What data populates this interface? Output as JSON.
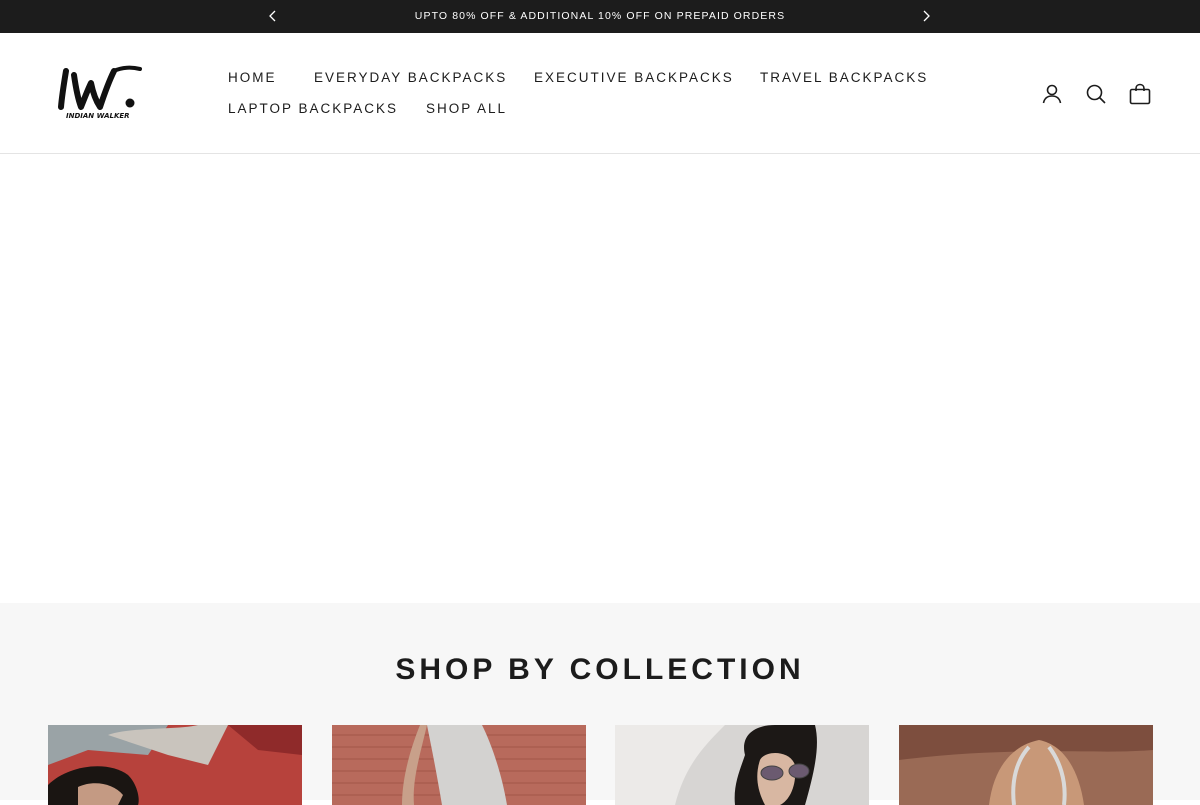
{
  "announcement": {
    "text": "UPTO 80% OFF & ADDITIONAL 10% OFF ON PREPAID ORDERS",
    "prev_icon": "chevron-left-icon",
    "next_icon": "chevron-right-icon"
  },
  "header": {
    "logo": {
      "mark": "IW.",
      "tagline": "INDIAN WALKER"
    },
    "nav": [
      {
        "label": "HOME"
      },
      {
        "label": "EVERYDAY BACKPACKS"
      },
      {
        "label": "EXECUTIVE BACKPACKS"
      },
      {
        "label": "TRAVEL BACKPACKS"
      },
      {
        "label": "LAPTOP BACKPACKS"
      },
      {
        "label": "SHOP ALL"
      }
    ],
    "icons": [
      "account-icon",
      "search-icon",
      "cart-icon"
    ]
  },
  "collections": {
    "title": "SHOP BY COLLECTION",
    "cards": [
      {
        "image": "collection-image-1"
      },
      {
        "image": "collection-image-2"
      },
      {
        "image": "collection-image-3"
      },
      {
        "image": "collection-image-4"
      }
    ]
  },
  "colors": {
    "announcement_bg": "#1c1c1c",
    "text": "#1c1c1c",
    "section_bg": "#f7f7f7"
  }
}
